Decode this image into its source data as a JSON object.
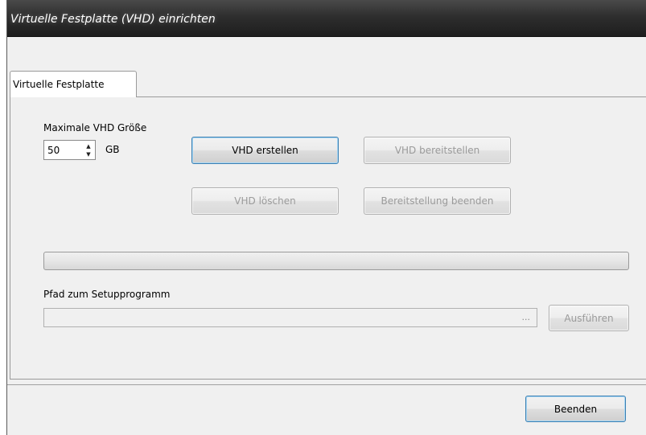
{
  "window": {
    "title": "Virtuelle Festplatte (VHD) einrichten"
  },
  "tab": {
    "label": "Virtuelle Festplatte"
  },
  "size": {
    "label": "Maximale VHD Größe",
    "value": "50",
    "unit": "GB"
  },
  "buttons": {
    "create": "VHD erstellen",
    "mount": "VHD bereitstellen",
    "delete": "VHD löschen",
    "unmount": "Bereitstellung beenden",
    "run": "Ausführen",
    "quit": "Beenden"
  },
  "progress": {
    "value": 0
  },
  "setup": {
    "label": "Pfad zum Setupprogramm",
    "path": "",
    "browse": "..."
  }
}
